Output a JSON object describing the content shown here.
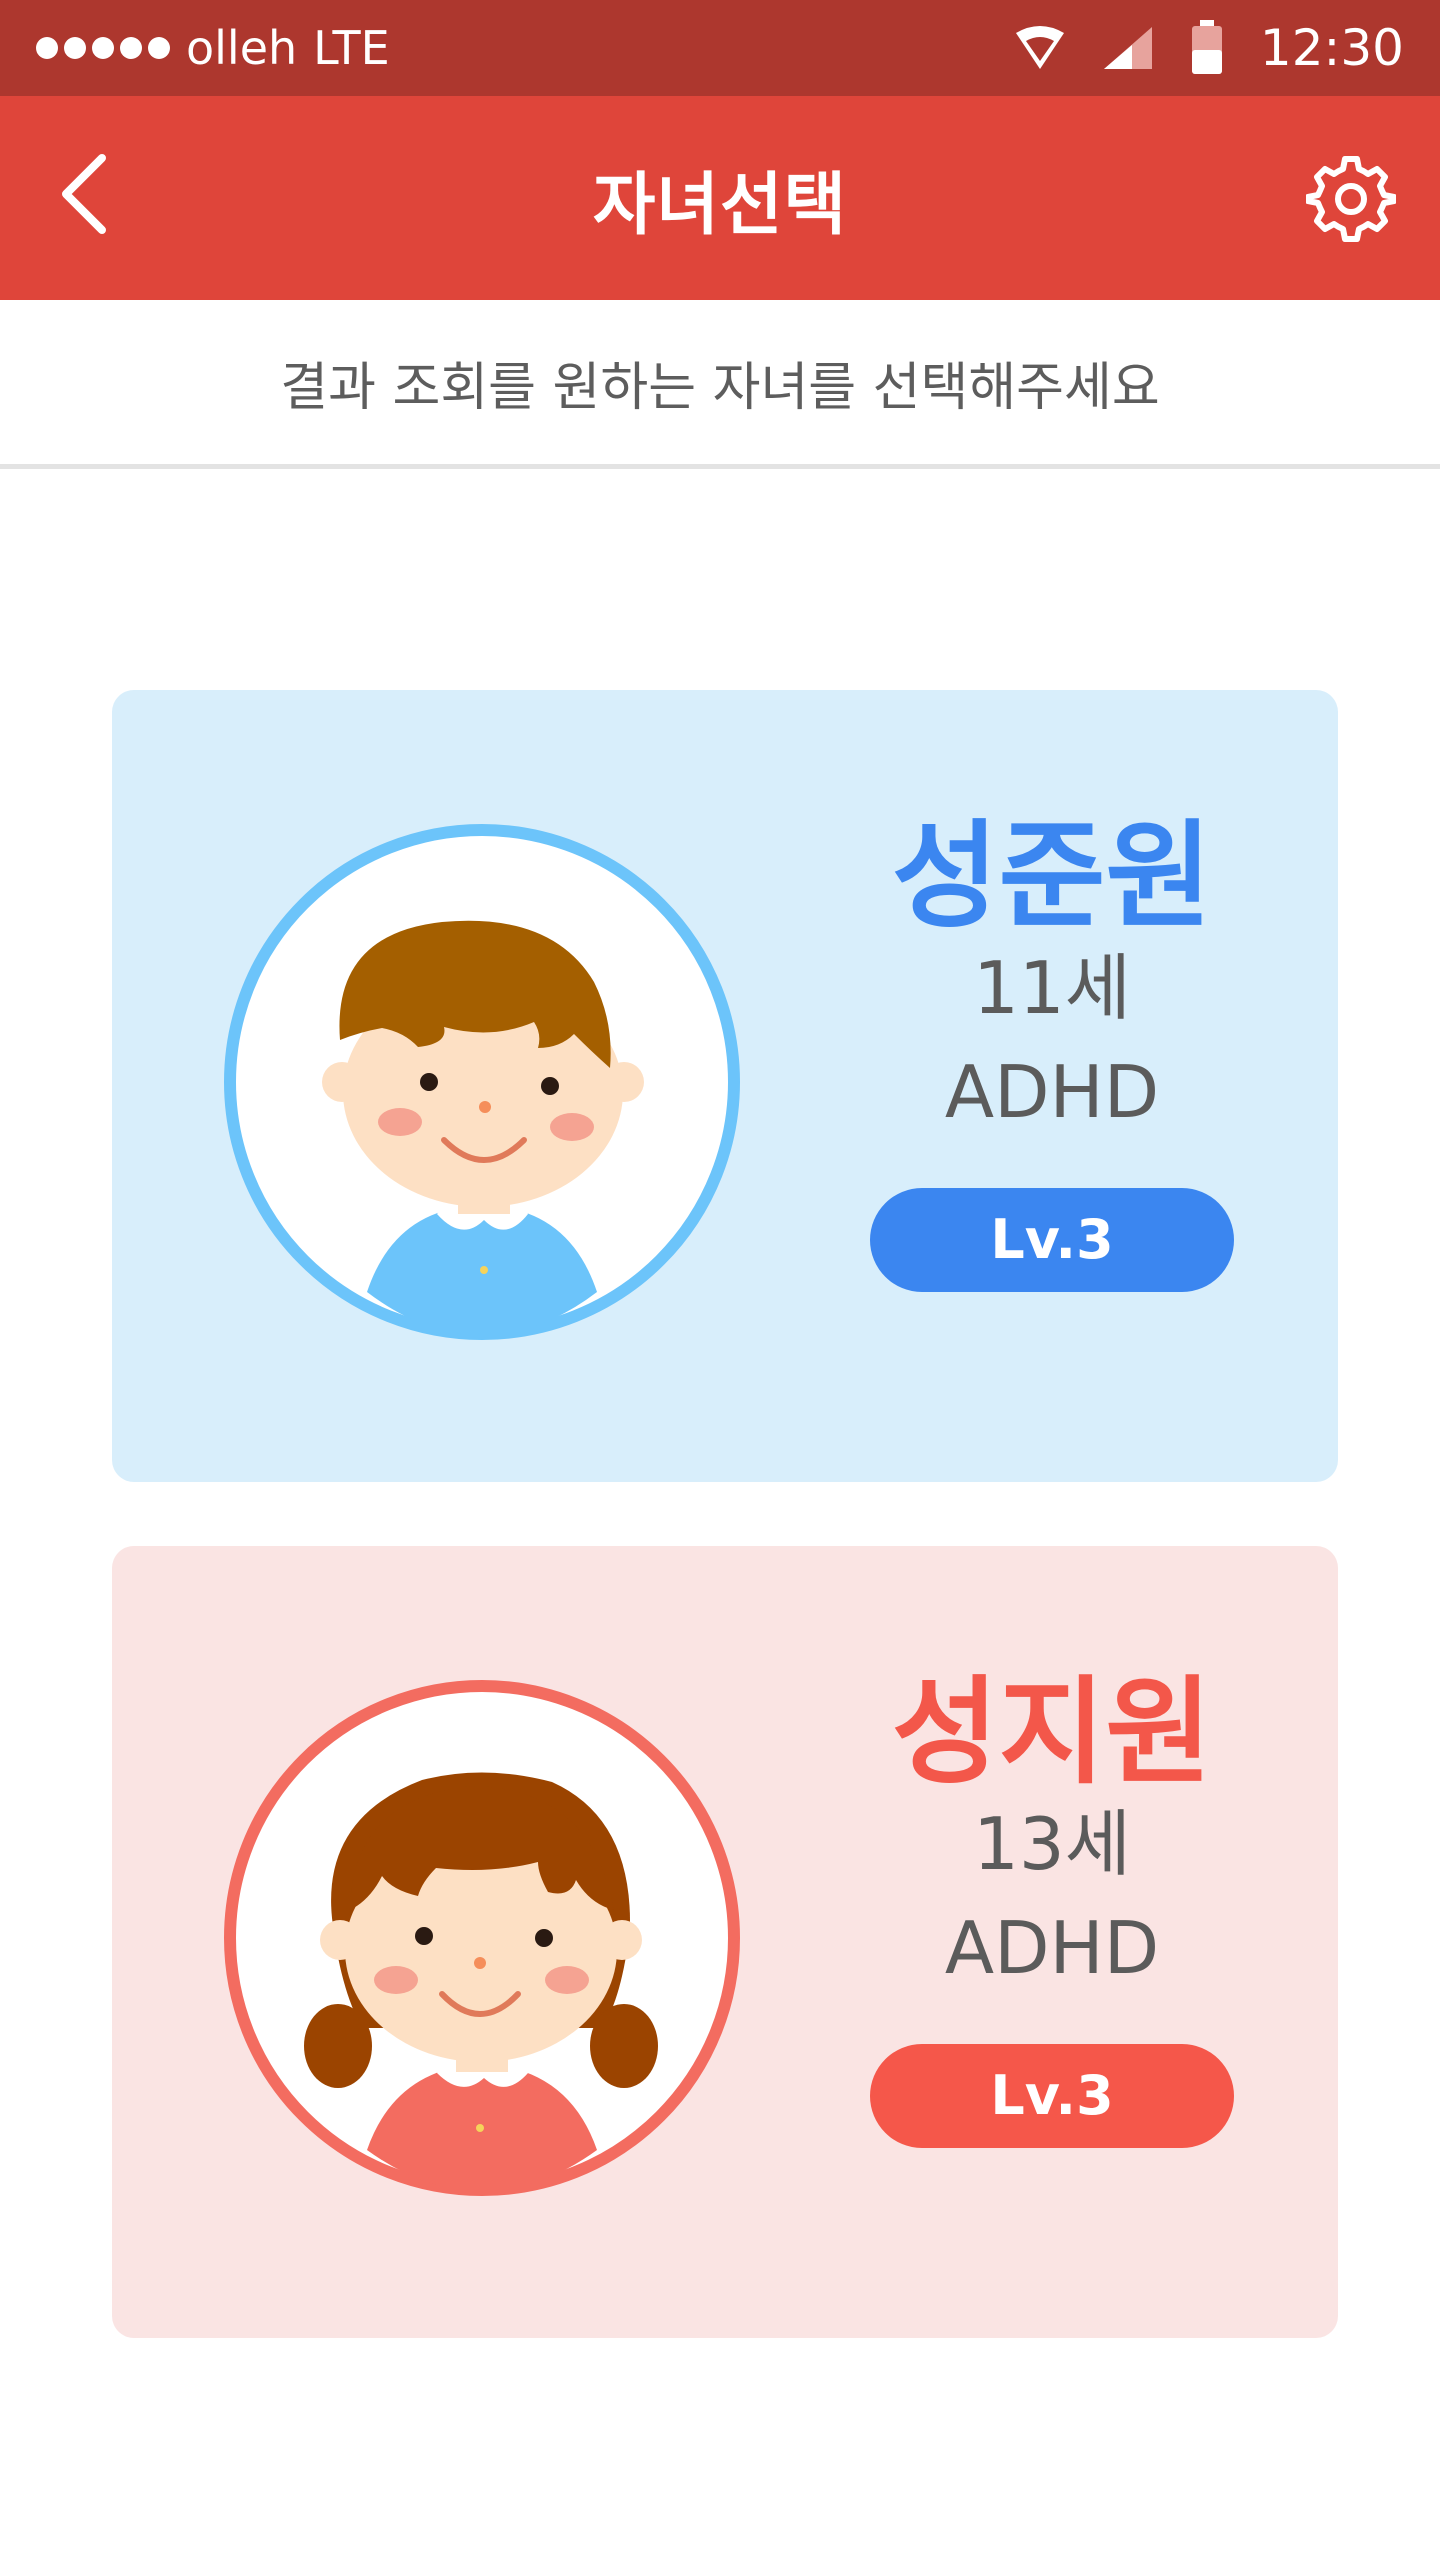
{
  "status_bar": {
    "carrier": "olleh",
    "network": "LTE",
    "time": "12:30"
  },
  "app_bar": {
    "title": "자녀선택",
    "back_icon": "chevron-left-icon",
    "settings_icon": "gear-icon"
  },
  "instruction": "결과 조회를 원하는 자녀를 선택해주세요",
  "children": [
    {
      "name": "성준원",
      "age": "11세",
      "diagnosis": "ADHD",
      "level": "Lv.3",
      "accent": "#3b86f0",
      "card_bg": "#d8eefb",
      "avatar": "boy-avatar"
    },
    {
      "name": "성지원",
      "age": "13세",
      "diagnosis": "ADHD",
      "level": "Lv.3",
      "accent": "#f5574a",
      "card_bg": "#fae4e3",
      "avatar": "girl-avatar"
    }
  ],
  "colors": {
    "status_bar": "#ad372e",
    "app_bar": "#df453a"
  }
}
